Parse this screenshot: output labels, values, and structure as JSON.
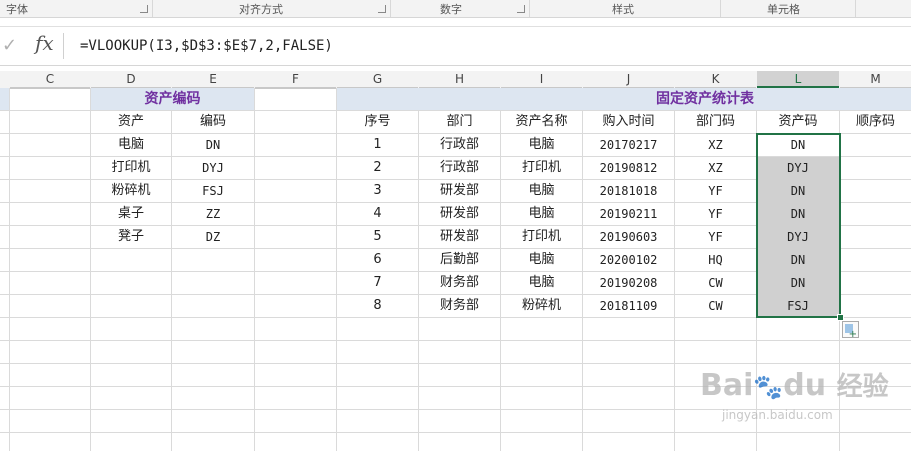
{
  "ribbon": {
    "groups": [
      {
        "label": "字体"
      },
      {
        "label": "对齐方式"
      },
      {
        "label": "数字"
      },
      {
        "label": "样式"
      },
      {
        "label": "单元格"
      }
    ]
  },
  "formula_bar": {
    "fx_label": "fx",
    "formula": "=VLOOKUP(I3,$D$3:$E$7,2,FALSE)"
  },
  "columns": [
    "C",
    "D",
    "E",
    "F",
    "G",
    "H",
    "I",
    "J",
    "K",
    "L",
    "M"
  ],
  "selected_column": "L",
  "left_table": {
    "title": "资产编码",
    "headers": [
      "资产",
      "编码"
    ],
    "rows": [
      [
        "电脑",
        "DN"
      ],
      [
        "打印机",
        "DYJ"
      ],
      [
        "粉碎机",
        "FSJ"
      ],
      [
        "桌子",
        "ZZ"
      ],
      [
        "凳子",
        "DZ"
      ]
    ]
  },
  "right_table": {
    "title": "固定资产统计表",
    "headers": [
      "序号",
      "部门",
      "资产名称",
      "购入时间",
      "部门码",
      "资产码",
      "顺序码"
    ],
    "rows": [
      [
        "1",
        "行政部",
        "电脑",
        "20170217",
        "XZ",
        "DN",
        ""
      ],
      [
        "2",
        "行政部",
        "打印机",
        "20190812",
        "XZ",
        "DYJ",
        ""
      ],
      [
        "3",
        "研发部",
        "电脑",
        "20181018",
        "YF",
        "DN",
        ""
      ],
      [
        "4",
        "研发部",
        "电脑",
        "20190211",
        "YF",
        "DN",
        ""
      ],
      [
        "5",
        "研发部",
        "打印机",
        "20190603",
        "YF",
        "DYJ",
        ""
      ],
      [
        "6",
        "后勤部",
        "电脑",
        "20200102",
        "HQ",
        "DN",
        ""
      ],
      [
        "7",
        "财务部",
        "电脑",
        "20190208",
        "CW",
        "DN",
        ""
      ],
      [
        "8",
        "财务部",
        "粉碎机",
        "20181109",
        "CW",
        "FSJ",
        ""
      ]
    ]
  },
  "watermark": {
    "brand": "Bai",
    "brand2": "du",
    "suffix": "经验",
    "url": "jingyan.baidu.com"
  }
}
